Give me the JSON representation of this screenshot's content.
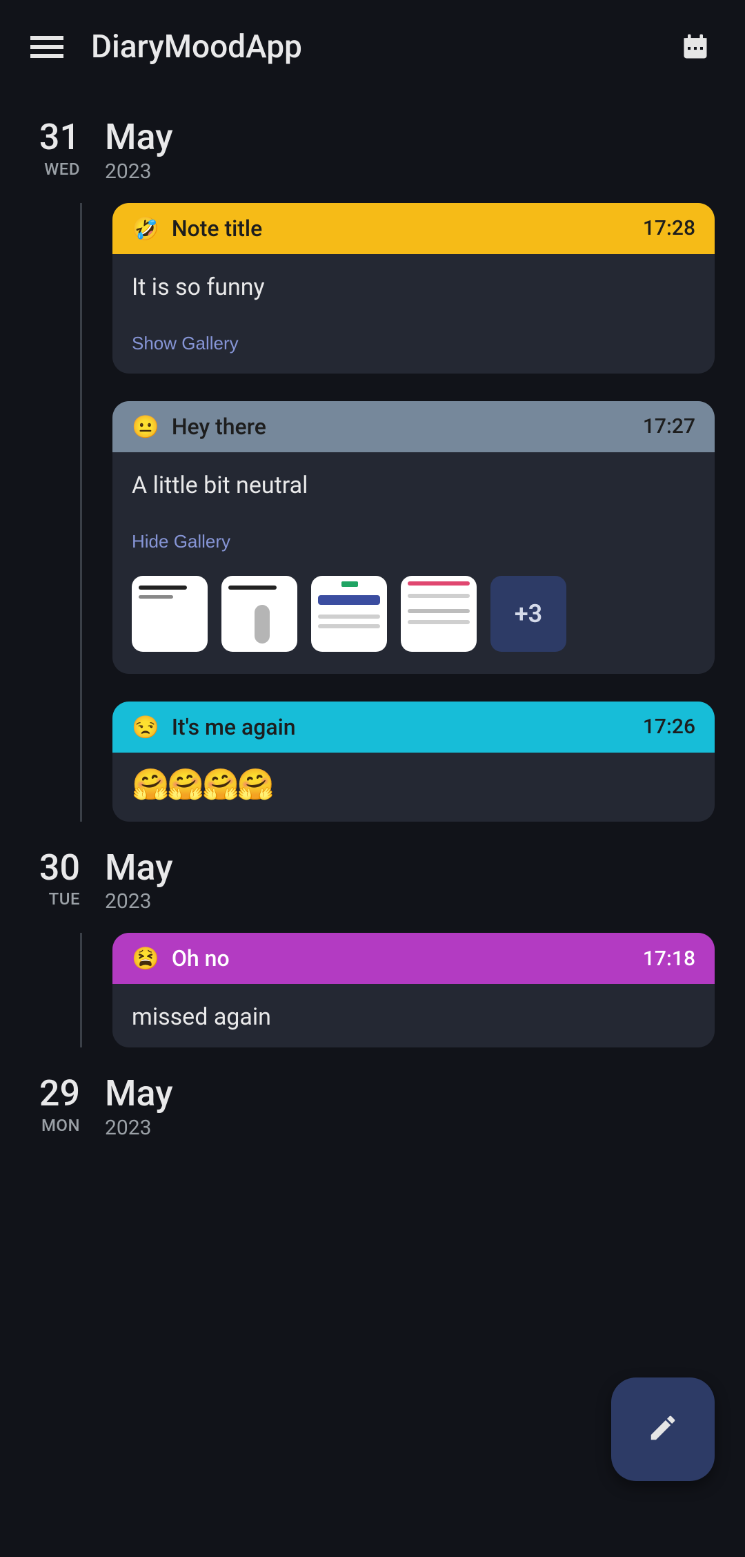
{
  "appbar": {
    "title": "DiaryMoodApp"
  },
  "days": [
    {
      "day_num": "31",
      "dow": "WED",
      "month": "May",
      "year": "2023",
      "entries": [
        {
          "mood_emoji": "🤣",
          "title": "Note title",
          "time": "17:28",
          "body": "It is so funny",
          "gallery_toggle": "Show Gallery",
          "header_class": "hdr-yellow"
        },
        {
          "mood_emoji": "😐",
          "title": "Hey there",
          "time": "17:27",
          "body": "A little bit neutral",
          "gallery_toggle": "Hide Gallery",
          "header_class": "hdr-grey",
          "gallery_more": "+3"
        },
        {
          "mood_emoji": "😒",
          "title": "It's me again",
          "time": "17:26",
          "body_emojis": "🤗🤗🤗🤗",
          "header_class": "hdr-cyan"
        }
      ]
    },
    {
      "day_num": "30",
      "dow": "TUE",
      "month": "May",
      "year": "2023",
      "entries": [
        {
          "mood_emoji": "😫",
          "title": "Oh no",
          "time": "17:18",
          "body": "missed again",
          "header_class": "hdr-purple"
        }
      ]
    },
    {
      "day_num": "29",
      "dow": "MON",
      "month": "May",
      "year": "2023",
      "entries": []
    }
  ]
}
